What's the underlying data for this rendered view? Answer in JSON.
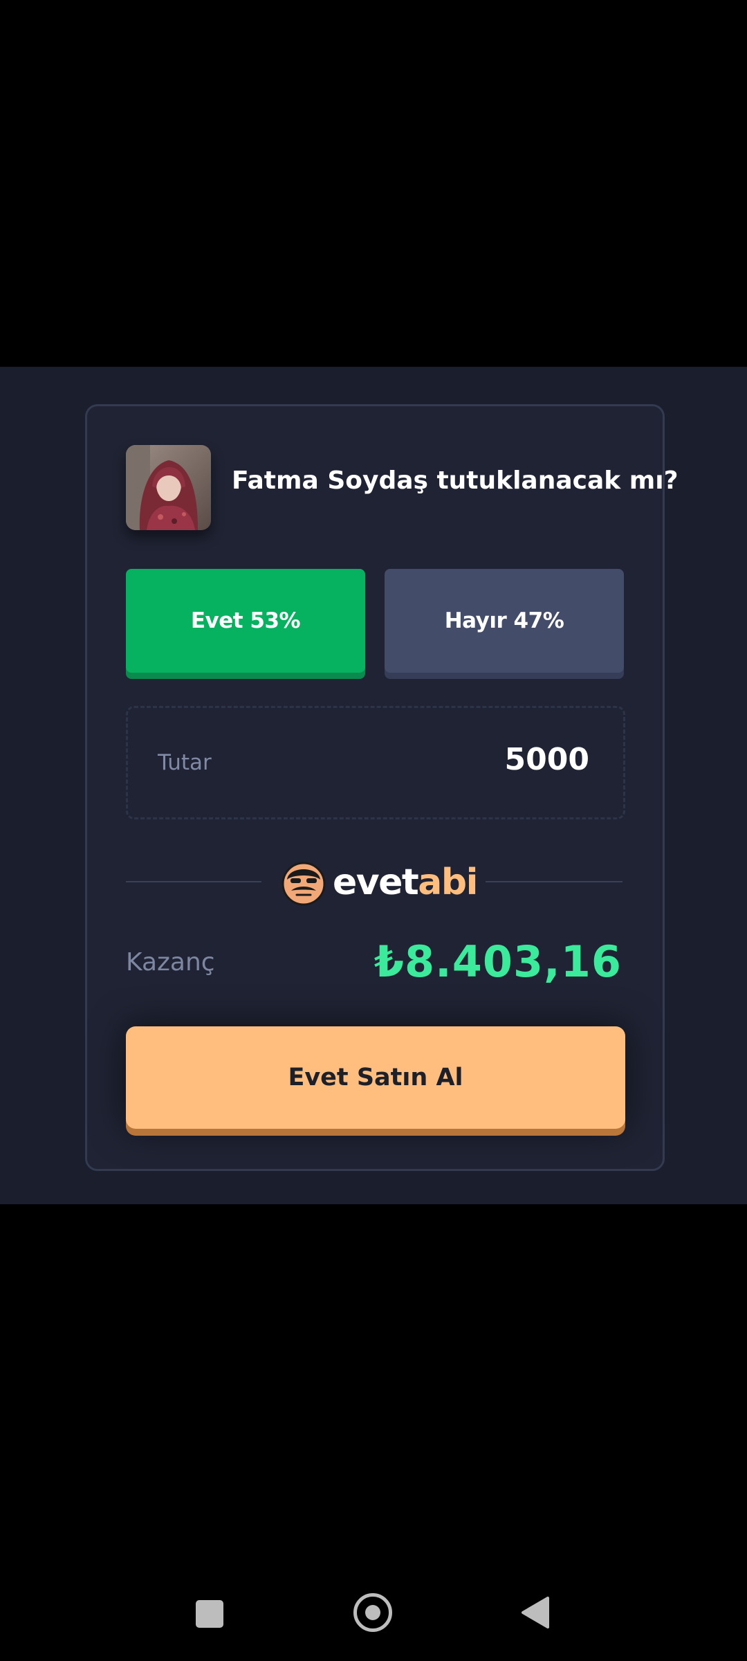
{
  "question": {
    "title": "Fatma Soydaş tutuklanacak mı?",
    "avatar_icon": "person-photo"
  },
  "options": {
    "yes_label": "Evet 53%",
    "yes_percent": 53,
    "no_label": "Hayır 47%",
    "no_percent": 47
  },
  "amount": {
    "label": "Tutar",
    "value": "5000"
  },
  "brand": {
    "part1": "evet",
    "part2": "abi",
    "logo_icon": "mustache-face-icon"
  },
  "earnings": {
    "label": "Kazanç",
    "value": "₺8.403,16"
  },
  "buy_button": {
    "label": "Evet Satın Al"
  },
  "colors": {
    "yes": "#06b25f",
    "no": "#434c69",
    "accent": "#ffbe7e",
    "earnings": "#3bea9a"
  },
  "navbar": {
    "icons": [
      "recent-apps-icon",
      "home-icon",
      "back-icon"
    ]
  }
}
